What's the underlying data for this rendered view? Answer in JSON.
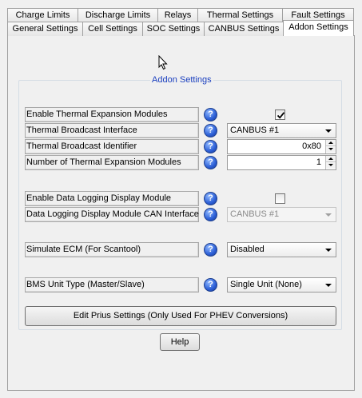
{
  "tabs_row1": [
    "Charge Limits",
    "Discharge Limits",
    "Relays",
    "Thermal Settings",
    "Fault Settings"
  ],
  "tabs_row2": [
    "General Settings",
    "Cell Settings",
    "SOC Settings",
    "CANBUS Settings",
    "Addon Settings"
  ],
  "active_tab": "Addon Settings",
  "group_title": "Addon Settings",
  "help_glyph": "?",
  "settings": {
    "thermal_expansion": {
      "label": "Enable Thermal  Expansion Modules",
      "checked": true
    },
    "thermal_broadcast_interface": {
      "label": "Thermal Broadcast Interface",
      "value": "CANBUS #1"
    },
    "thermal_broadcast_identifier": {
      "label": "Thermal Broadcast Identifier",
      "value": "0x80"
    },
    "num_thermal_modules": {
      "label": "Number of Thermal Expansion Modules",
      "value": "1"
    },
    "data_logging_display": {
      "label": "Enable Data Logging Display Module",
      "checked": false
    },
    "data_logging_can_interface": {
      "label": "Data Logging Display Module CAN Interface",
      "value": "CANBUS #1",
      "disabled": true
    },
    "simulate_ecm": {
      "label": "Simulate ECM (For Scantool)",
      "value": "Disabled"
    },
    "bms_unit_type": {
      "label": "BMS Unit Type (Master/Slave)",
      "value": "Single Unit (None)"
    }
  },
  "prius_button": "Edit Prius Settings (Only Used For PHEV Conversions)",
  "help_button": "Help"
}
